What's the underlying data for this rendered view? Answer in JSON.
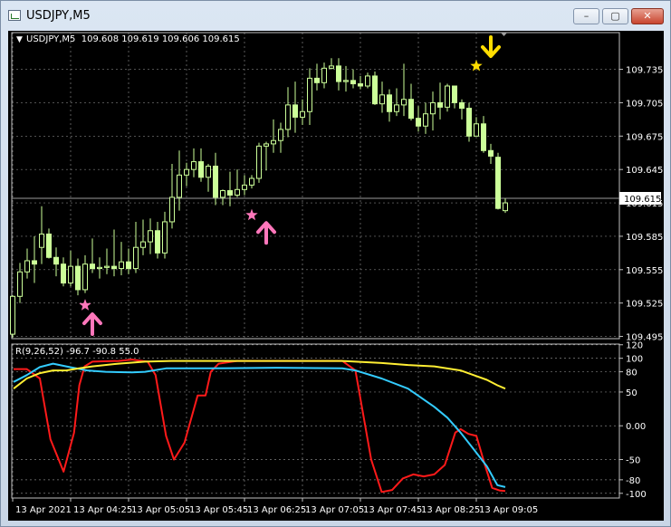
{
  "window": {
    "title": "USDJPY,M5",
    "minimize": "–",
    "maximize": "▢",
    "close": "✕"
  },
  "main_header": {
    "arrow": "▼",
    "text": "USDJPY,M5  109.608 109.619 109.606 109.615"
  },
  "sub_header": "R(9,26,52) -96.7 -90.8 55.0",
  "current_price": "109.615",
  "colors": {
    "background": "#000000",
    "grid": "#808080",
    "candle": "#ccff99",
    "red_line": "#ff1a1a",
    "cyan_line": "#33ccff",
    "yellow_line": "#ffee33",
    "pink_marker": "#ff77bb",
    "yellow_marker": "#ffdd00"
  },
  "chart_data": [
    {
      "type": "candlestick",
      "symbol": "USDJPY",
      "timeframe": "M5",
      "ylim": [
        109.493,
        109.768
      ],
      "yticks": [
        "109.735",
        "109.705",
        "109.675",
        "109.645",
        "109.615",
        "109.585",
        "109.555",
        "109.525",
        "109.495"
      ],
      "grid": true,
      "candles": [
        {
          "o": 109.497,
          "h": 109.532,
          "l": 109.494,
          "c": 109.531
        },
        {
          "o": 109.531,
          "h": 109.561,
          "l": 109.525,
          "c": 109.553
        },
        {
          "o": 109.553,
          "h": 109.574,
          "l": 109.547,
          "c": 109.563
        },
        {
          "o": 109.563,
          "h": 109.585,
          "l": 109.543,
          "c": 109.56
        },
        {
          "o": 109.575,
          "h": 109.612,
          "l": 109.56,
          "c": 109.587
        },
        {
          "o": 109.587,
          "h": 109.592,
          "l": 109.565,
          "c": 109.566
        },
        {
          "o": 109.566,
          "h": 109.575,
          "l": 109.549,
          "c": 109.56
        },
        {
          "o": 109.56,
          "h": 109.566,
          "l": 109.54,
          "c": 109.543
        },
        {
          "o": 109.543,
          "h": 109.572,
          "l": 109.54,
          "c": 109.558
        },
        {
          "o": 109.558,
          "h": 109.565,
          "l": 109.532,
          "c": 109.537
        },
        {
          "o": 109.537,
          "h": 109.568,
          "l": 109.534,
          "c": 109.56
        },
        {
          "o": 109.56,
          "h": 109.583,
          "l": 109.552,
          "c": 109.556
        },
        {
          "o": 109.556,
          "h": 109.566,
          "l": 109.547,
          "c": 109.557
        },
        {
          "o": 109.557,
          "h": 109.574,
          "l": 109.551,
          "c": 109.558
        },
        {
          "o": 109.558,
          "h": 109.591,
          "l": 109.549,
          "c": 109.556
        },
        {
          "o": 109.556,
          "h": 109.58,
          "l": 109.55,
          "c": 109.562
        },
        {
          "o": 109.562,
          "h": 109.574,
          "l": 109.551,
          "c": 109.556
        },
        {
          "o": 109.556,
          "h": 109.598,
          "l": 109.552,
          "c": 109.575
        },
        {
          "o": 109.575,
          "h": 109.6,
          "l": 109.568,
          "c": 109.58
        },
        {
          "o": 109.58,
          "h": 109.601,
          "l": 109.569,
          "c": 109.59
        },
        {
          "o": 109.59,
          "h": 109.598,
          "l": 109.565,
          "c": 109.57
        },
        {
          "o": 109.57,
          "h": 109.607,
          "l": 109.565,
          "c": 109.598
        },
        {
          "o": 109.598,
          "h": 109.65,
          "l": 109.592,
          "c": 109.62
        },
        {
          "o": 109.62,
          "h": 109.662,
          "l": 109.608,
          "c": 109.64
        },
        {
          "o": 109.64,
          "h": 109.651,
          "l": 109.63,
          "c": 109.645
        },
        {
          "o": 109.645,
          "h": 109.664,
          "l": 109.638,
          "c": 109.652
        },
        {
          "o": 109.652,
          "h": 109.664,
          "l": 109.634,
          "c": 109.638
        },
        {
          "o": 109.638,
          "h": 109.65,
          "l": 109.625,
          "c": 109.648
        },
        {
          "o": 109.648,
          "h": 109.66,
          "l": 109.613,
          "c": 109.62
        },
        {
          "o": 109.62,
          "h": 109.627,
          "l": 109.613,
          "c": 109.626
        },
        {
          "o": 109.626,
          "h": 109.643,
          "l": 109.612,
          "c": 109.622
        },
        {
          "o": 109.622,
          "h": 109.645,
          "l": 109.62,
          "c": 109.627
        },
        {
          "o": 109.627,
          "h": 109.64,
          "l": 109.622,
          "c": 109.631
        },
        {
          "o": 109.631,
          "h": 109.64,
          "l": 109.628,
          "c": 109.637
        },
        {
          "o": 109.637,
          "h": 109.669,
          "l": 109.633,
          "c": 109.666
        },
        {
          "o": 109.666,
          "h": 109.67,
          "l": 109.644,
          "c": 109.668
        },
        {
          "o": 109.668,
          "h": 109.69,
          "l": 109.66,
          "c": 109.671
        },
        {
          "o": 109.671,
          "h": 109.687,
          "l": 109.66,
          "c": 109.681
        },
        {
          "o": 109.681,
          "h": 109.719,
          "l": 109.674,
          "c": 109.703
        },
        {
          "o": 109.703,
          "h": 109.724,
          "l": 109.678,
          "c": 109.692
        },
        {
          "o": 109.692,
          "h": 109.708,
          "l": 109.685,
          "c": 109.697
        },
        {
          "o": 109.697,
          "h": 109.736,
          "l": 109.685,
          "c": 109.727
        },
        {
          "o": 109.727,
          "h": 109.74,
          "l": 109.716,
          "c": 109.723
        },
        {
          "o": 109.723,
          "h": 109.741,
          "l": 109.718,
          "c": 109.736
        },
        {
          "o": 109.736,
          "h": 109.745,
          "l": 109.735,
          "c": 109.738
        },
        {
          "o": 109.738,
          "h": 109.745,
          "l": 109.716,
          "c": 109.724
        },
        {
          "o": 109.724,
          "h": 109.738,
          "l": 109.715,
          "c": 109.725
        },
        {
          "o": 109.725,
          "h": 109.735,
          "l": 109.718,
          "c": 109.722
        },
        {
          "o": 109.722,
          "h": 109.729,
          "l": 109.717,
          "c": 109.72
        },
        {
          "o": 109.72,
          "h": 109.732,
          "l": 109.718,
          "c": 109.729
        },
        {
          "o": 109.729,
          "h": 109.733,
          "l": 109.703,
          "c": 109.704
        },
        {
          "o": 109.704,
          "h": 109.724,
          "l": 109.696,
          "c": 109.712
        },
        {
          "o": 109.712,
          "h": 109.717,
          "l": 109.688,
          "c": 109.697
        },
        {
          "o": 109.697,
          "h": 109.718,
          "l": 109.693,
          "c": 109.703
        },
        {
          "o": 109.703,
          "h": 109.74,
          "l": 109.693,
          "c": 109.708
        },
        {
          "o": 109.708,
          "h": 109.722,
          "l": 109.689,
          "c": 109.691
        },
        {
          "o": 109.691,
          "h": 109.702,
          "l": 109.679,
          "c": 109.684
        },
        {
          "o": 109.684,
          "h": 109.705,
          "l": 109.677,
          "c": 109.695
        },
        {
          "o": 109.695,
          "h": 109.715,
          "l": 109.68,
          "c": 109.705
        },
        {
          "o": 109.705,
          "h": 109.723,
          "l": 109.69,
          "c": 109.701
        },
        {
          "o": 109.701,
          "h": 109.722,
          "l": 109.697,
          "c": 109.72
        },
        {
          "o": 109.72,
          "h": 109.72,
          "l": 109.7,
          "c": 109.705
        },
        {
          "o": 109.705,
          "h": 109.708,
          "l": 109.69,
          "c": 109.7
        },
        {
          "o": 109.7,
          "h": 109.705,
          "l": 109.67,
          "c": 109.675
        },
        {
          "o": 109.675,
          "h": 109.692,
          "l": 109.675,
          "c": 109.686
        },
        {
          "o": 109.686,
          "h": 109.693,
          "l": 109.66,
          "c": 109.662
        },
        {
          "o": 109.662,
          "h": 109.668,
          "l": 109.65,
          "c": 109.657
        },
        {
          "o": 109.656,
          "h": 109.66,
          "l": 109.609,
          "c": 109.61
        },
        {
          "o": 109.608,
          "h": 109.619,
          "l": 109.606,
          "c": 109.615
        }
      ],
      "markers": [
        {
          "type": "star",
          "color": "#ff77bb",
          "index": 10,
          "price": 109.523
        },
        {
          "type": "up_arrow",
          "color": "#ff77bb",
          "index": 11,
          "price": 109.506
        },
        {
          "type": "star",
          "color": "#ff77bb",
          "index": 33,
          "price": 109.604
        },
        {
          "type": "up_arrow",
          "color": "#ff77bb",
          "index": 35,
          "price": 109.588
        },
        {
          "type": "star",
          "color": "#ffdd00",
          "index": 64,
          "price": 109.738
        },
        {
          "type": "down_arrow",
          "color": "#ffdd00",
          "index": 66,
          "price": 109.755
        }
      ]
    },
    {
      "type": "line",
      "title": "R(9,26,52) -96.7 -90.8 55.0",
      "ylim": [
        -107,
        121
      ],
      "yticks": [
        120,
        100,
        80,
        50,
        0.0,
        -50,
        -80,
        -100
      ],
      "ytick_labels": [
        "120",
        "100",
        "80",
        "50",
        "0.00",
        "-50",
        "-80",
        "-100"
      ],
      "xticks": [
        "13 Apr 2021",
        "13 Apr 04:25",
        "13 Apr 05:05",
        "13 Apr 05:45",
        "13 Apr 06:25",
        "13 Apr 07:05",
        "13 Apr 07:45",
        "13 Apr 08:25",
        "13 Apr 09:05"
      ],
      "series": [
        {
          "color": "#ff1a1a",
          "points": [
            [
              0,
              84
            ],
            [
              5,
              84
            ],
            [
              10,
              70
            ],
            [
              14,
              -20
            ],
            [
              19,
              -68
            ],
            [
              23,
              -10
            ],
            [
              25,
              60
            ],
            [
              27,
              88
            ],
            [
              30,
              95
            ],
            [
              40,
              96
            ],
            [
              45,
              98
            ],
            [
              51,
              95
            ],
            [
              54,
              75
            ],
            [
              58,
              -15
            ],
            [
              61,
              -50
            ],
            [
              65,
              -25
            ],
            [
              70,
              45
            ],
            [
              73,
              45
            ],
            [
              75,
              80
            ],
            [
              78,
              92
            ],
            [
              85,
              96
            ],
            [
              100,
              96
            ],
            [
              110,
              96
            ],
            [
              125,
              96
            ],
            [
              130,
              82
            ],
            [
              136,
              -50
            ],
            [
              140,
              -98
            ],
            [
              144,
              -95
            ],
            [
              148,
              -78
            ],
            [
              152,
              -72
            ],
            [
              156,
              -75
            ],
            [
              160,
              -72
            ],
            [
              164,
              -58
            ],
            [
              168,
              -10
            ],
            [
              170,
              -5
            ],
            [
              173,
              -12
            ],
            [
              176,
              -15
            ],
            [
              179,
              -55
            ],
            [
              182,
              -92
            ],
            [
              185,
              -96
            ],
            [
              187,
              -96.7
            ]
          ]
        },
        {
          "color": "#33ccff",
          "points": [
            [
              0,
              65
            ],
            [
              5,
              75
            ],
            [
              10,
              87
            ],
            [
              15,
              92
            ],
            [
              20,
              88
            ],
            [
              28,
              82
            ],
            [
              35,
              80
            ],
            [
              45,
              79
            ],
            [
              50,
              80
            ],
            [
              58,
              85
            ],
            [
              60,
              85
            ],
            [
              75,
              85
            ],
            [
              100,
              86
            ],
            [
              125,
              85
            ],
            [
              130,
              82
            ],
            [
              140,
              70
            ],
            [
              150,
              55
            ],
            [
              160,
              28
            ],
            [
              165,
              12
            ],
            [
              170,
              -10
            ],
            [
              175,
              -35
            ],
            [
              180,
              -60
            ],
            [
              184,
              -88
            ],
            [
              187,
              -90.8
            ]
          ]
        },
        {
          "color": "#ffee33",
          "points": [
            [
              0,
              55
            ],
            [
              5,
              70
            ],
            [
              10,
              78
            ],
            [
              15,
              82
            ],
            [
              20,
              82
            ],
            [
              25,
              85
            ],
            [
              30,
              88
            ],
            [
              40,
              92
            ],
            [
              50,
              95
            ],
            [
              60,
              96
            ],
            [
              70,
              96
            ],
            [
              90,
              96
            ],
            [
              110,
              96
            ],
            [
              125,
              96
            ],
            [
              130,
              95
            ],
            [
              140,
              93
            ],
            [
              150,
              90
            ],
            [
              160,
              88
            ],
            [
              170,
              82
            ],
            [
              175,
              75
            ],
            [
              180,
              68
            ],
            [
              184,
              60
            ],
            [
              187,
              55
            ]
          ]
        }
      ]
    }
  ]
}
